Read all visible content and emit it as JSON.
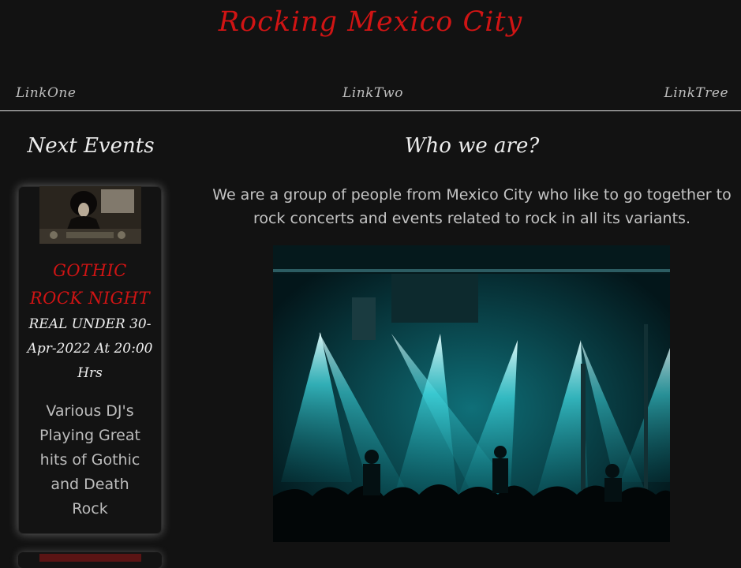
{
  "header": {
    "title": "Rocking Mexico City"
  },
  "nav": {
    "items": [
      "LinkOne",
      "LinkTwo",
      "LinkTree"
    ]
  },
  "sidebar": {
    "heading": "Next Events",
    "events": [
      {
        "title": "GOTHIC ROCK NIGHT",
        "date_line": "REAL UNDER 30-Apr-2022 At 20:00 Hrs",
        "description": "Various DJ's Playing Great hits of Gothic and Death Rock"
      }
    ]
  },
  "main": {
    "heading": "Who we are?",
    "text": "We are a group of people from Mexico City who like to go together to rock concerts and events related to rock in all its variants."
  },
  "colors": {
    "accent": "#d01414",
    "background": "#121212",
    "text": "#c4c4c4"
  }
}
